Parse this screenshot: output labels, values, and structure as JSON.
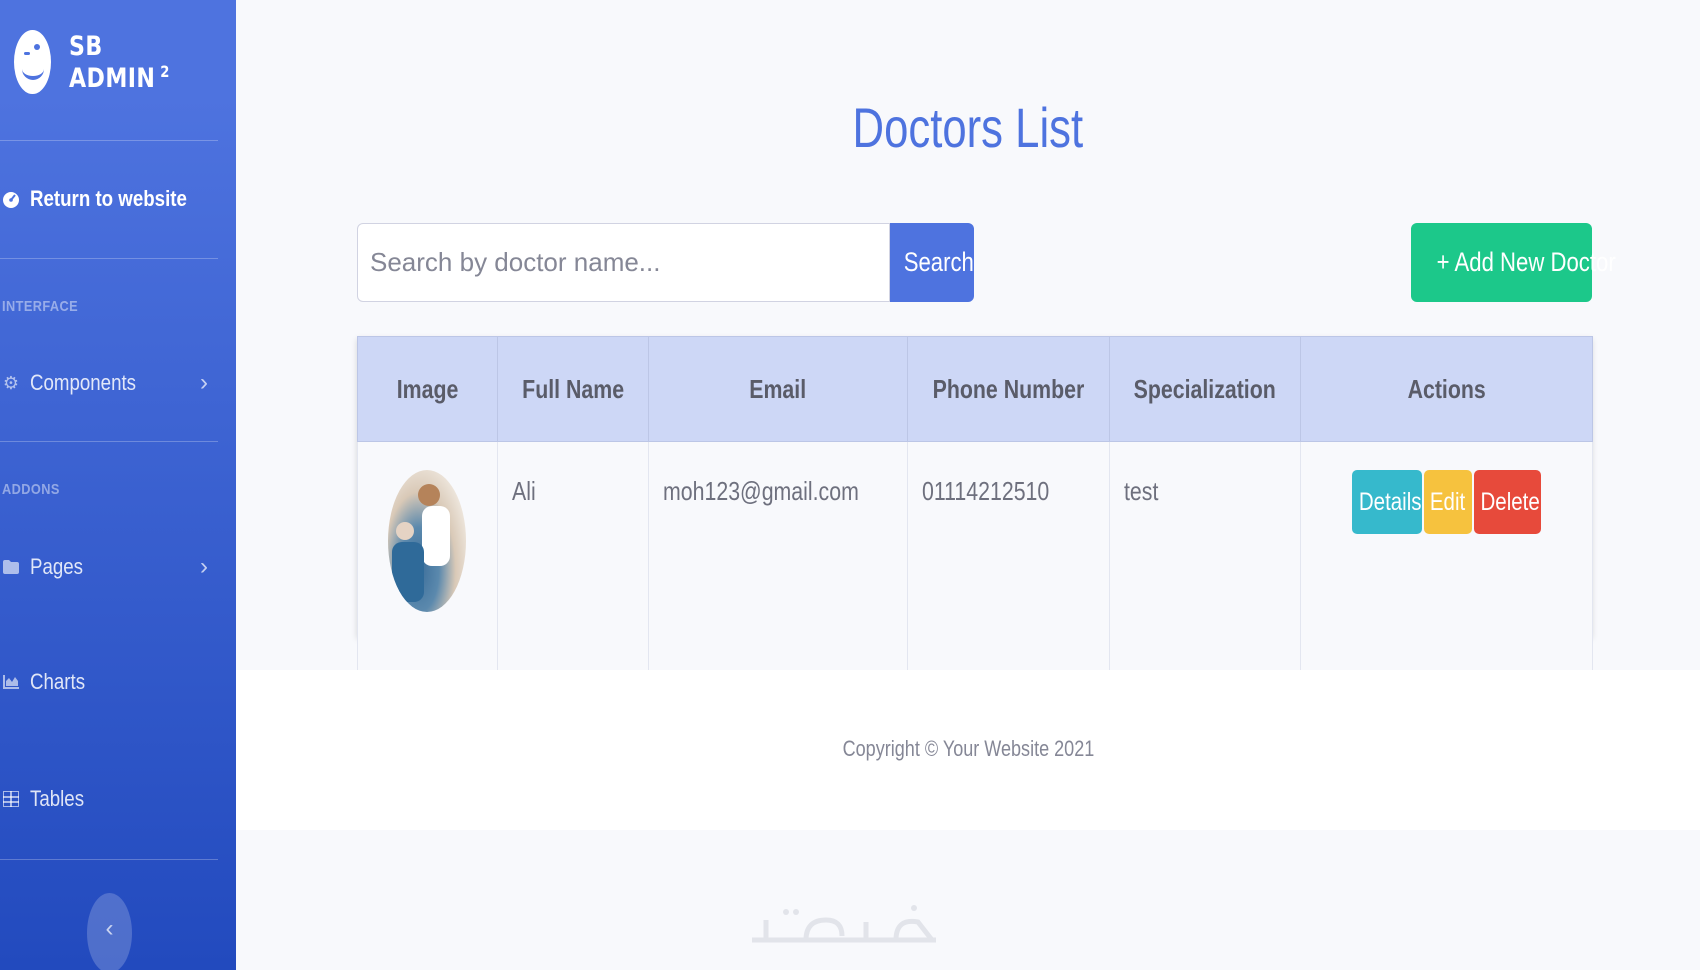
{
  "sidebar": {
    "brand": {
      "name": "SB ADMIN",
      "superscript": "2"
    },
    "return_link": "Return to website",
    "heading_interface": "INTERFACE",
    "heading_addons": "ADDONS",
    "items": [
      {
        "label": "Components",
        "icon": "gear-icon"
      },
      {
        "label": "Pages",
        "icon": "folder-icon"
      },
      {
        "label": "Charts",
        "icon": "chart-area-icon"
      },
      {
        "label": "Tables",
        "icon": "table-icon"
      }
    ],
    "toggle_glyph": "‹"
  },
  "main": {
    "title": "Doctors List",
    "search": {
      "placeholder": "Search by doctor name...",
      "button": "Search"
    },
    "add_button": "+ Add New Doctor",
    "table": {
      "headers": [
        "Image",
        "Full Name",
        "Email",
        "Phone Number",
        "Specialization",
        "Actions"
      ],
      "rows": [
        {
          "full_name": "Ali",
          "email": "moh123@gmail.com",
          "phone": "01114212510",
          "specialization": "test",
          "actions": {
            "details": "Details",
            "edit": "Edit",
            "delete": "Delete"
          }
        }
      ]
    }
  },
  "footer": {
    "copyright": "Copyright © Your Website 2021"
  },
  "colors": {
    "primary": "#4e73df",
    "success": "#1cc88a",
    "info": "#36b9cc",
    "warning": "#f6c23e",
    "danger": "#e74a3b"
  }
}
